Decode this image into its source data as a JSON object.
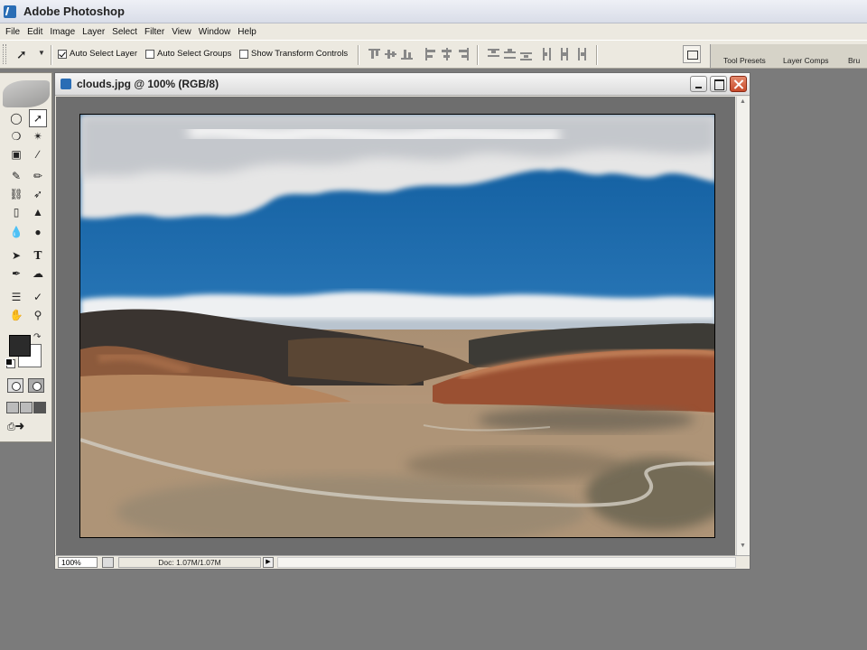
{
  "app": {
    "title": "Adobe Photoshop"
  },
  "menu": [
    "File",
    "Edit",
    "Image",
    "Layer",
    "Select",
    "Filter",
    "View",
    "Window",
    "Help"
  ],
  "options_bar": {
    "auto_select_layer": {
      "label": "Auto Select Layer",
      "checked": true
    },
    "auto_select_groups": {
      "label": "Auto Select Groups",
      "checked": false
    },
    "show_transform_controls": {
      "label": "Show Transform Controls",
      "checked": false
    }
  },
  "palette_well": {
    "tabs": [
      "Tool Presets",
      "Layer Comps",
      "Bru"
    ]
  },
  "toolbox": {
    "foreground_color": "#2b2b2b",
    "background_color": "#ffffff",
    "tools": [
      "elliptical-marquee",
      "move",
      "lasso",
      "magic-wand",
      "crop",
      "slice",
      "healing-brush",
      "brush",
      "clone-stamp",
      "history-brush",
      "eraser",
      "paint-bucket",
      "blur",
      "dodge",
      "path-selection",
      "type",
      "pen",
      "custom-shape",
      "notes",
      "eyedropper",
      "hand",
      "zoom"
    ]
  },
  "document": {
    "title": "clouds.jpg @ 100% (RGB/8)",
    "zoom": "100%",
    "doc_info": "Doc: 1.07M/1.07M"
  }
}
